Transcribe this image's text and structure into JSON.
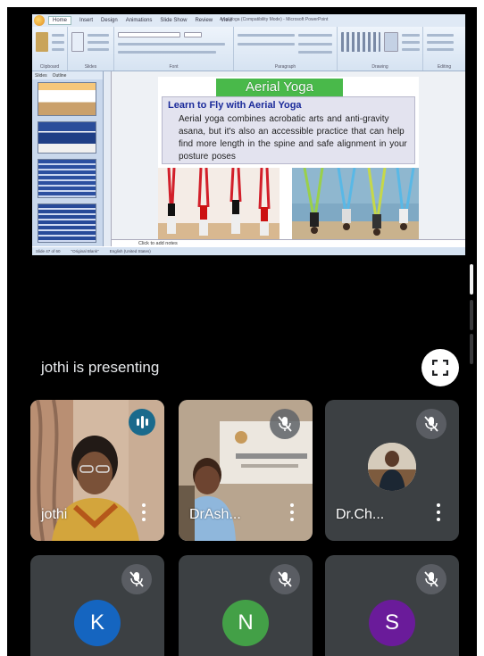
{
  "window": {
    "title": "Arial Yoga (Compatibility Mode) - Microsoft PowerPoint",
    "tabs": [
      "Home",
      "Insert",
      "Design",
      "Animations",
      "Slide Show",
      "Review",
      "View"
    ],
    "ribbon_groups": [
      "Clipboard",
      "Slides",
      "Font",
      "Paragraph",
      "Drawing",
      "Editing"
    ],
    "thumb_tabs": [
      "Slides",
      "Outline"
    ]
  },
  "slide": {
    "title": "Aerial Yoga",
    "subtitle": "Learn to Fly with Aerial Yoga",
    "body": "Aerial yoga combines acrobatic arts and anti-gravity asana, but it's also an accessible practice that can help find more length in the spine and safe alignment in your posture poses"
  },
  "notes": {
    "placeholder": "Click to add notes"
  },
  "status": {
    "slide_counter": "Slide 47 of 60",
    "theme": "\"Original Blank\"",
    "language": "English (United States)"
  },
  "presentation": {
    "presenting_text": "jothi is presenting"
  },
  "participants": [
    {
      "name": "jothi",
      "speaking": true
    },
    {
      "name": "DrAsh...",
      "muted": true
    },
    {
      "name": "Dr.Ch...",
      "muted": true
    },
    {
      "initial": "K",
      "muted": true,
      "color": "#1565c0"
    },
    {
      "initial": "N",
      "muted": true,
      "color": "#43a047"
    },
    {
      "initial": "S",
      "muted": true,
      "color": "#6a1b9a"
    }
  ],
  "colors": {
    "background": "#000000",
    "tile": "#3c4043",
    "speaking_ring": "#2f6f7a",
    "slide_title_bg": "#49b94a",
    "subtitle": "#1a2a9a"
  },
  "icons": [
    "microphone-off-icon",
    "audio-level-icon",
    "fullscreen-icon",
    "more-vert-icon"
  ]
}
